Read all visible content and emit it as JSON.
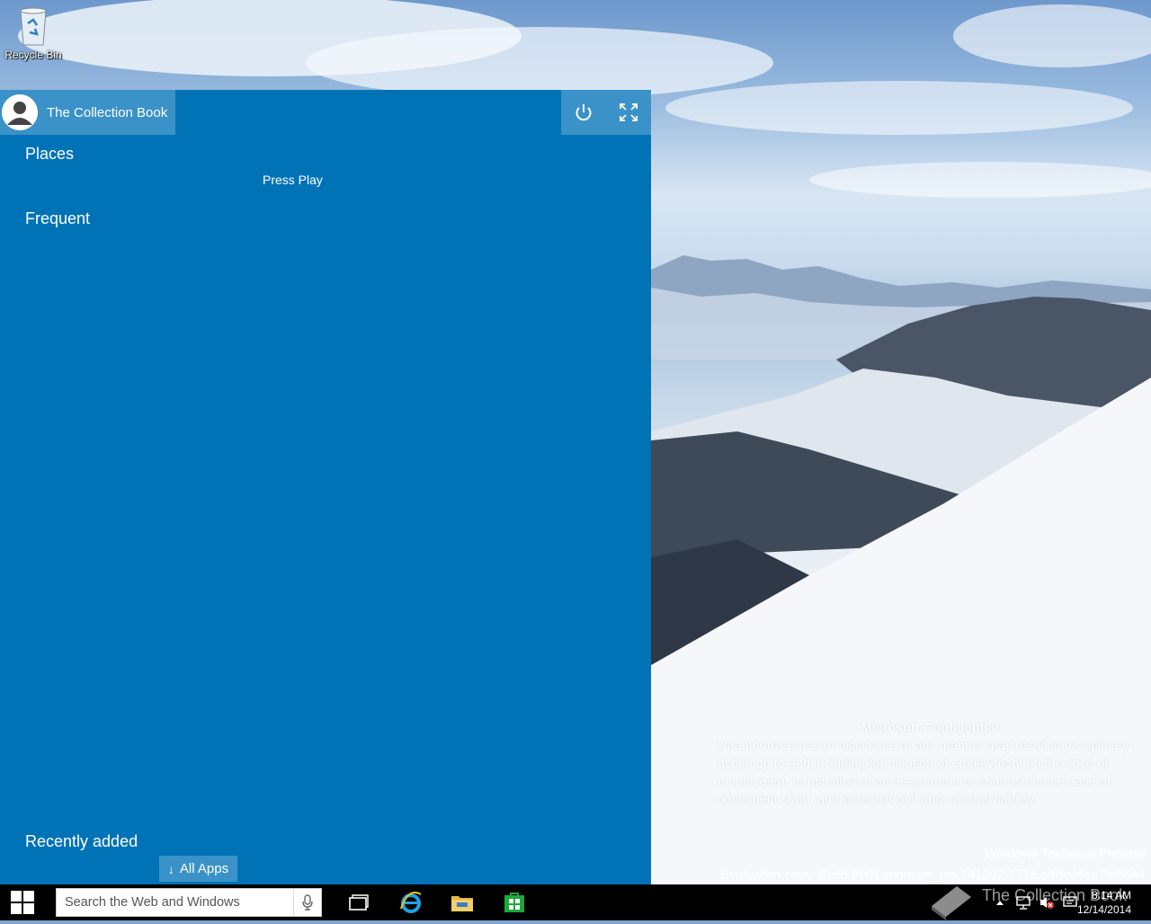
{
  "desktop": {
    "recycle_bin_label": "Recycle Bin"
  },
  "start_menu": {
    "user_name": "The Collection Book",
    "sections": {
      "places": "Places",
      "frequent": "Frequent",
      "recently_added": "Recently added"
    },
    "places_items": [
      "Press Play"
    ],
    "all_apps_label": "All Apps",
    "accent_color": "#0073b6",
    "tile_color": "#3a92c8"
  },
  "watermark": {
    "title": "Microsoft Confidential",
    "body": "Unauthorized use or disclosure in any manner may result in disciplinary action up to and including termination of employment (in the case of employees), termination of an assignment or contract (in the case of contingent staff), and potential civil and criminal liability.",
    "edition": "Windows Technical Preview",
    "build": "Evaluation copy. Build 9901.winmain_prs.141202-1718.c4f9af4aa7fe8544"
  },
  "taskbar": {
    "search_placeholder": "Search the Web and Windows",
    "apps": [
      "task-view-icon",
      "internet-explorer-icon",
      "file-explorer-icon",
      "store-icon"
    ],
    "overlay_text": "The Collection Book",
    "time": "8:14 AM",
    "date": "12/14/2014"
  }
}
